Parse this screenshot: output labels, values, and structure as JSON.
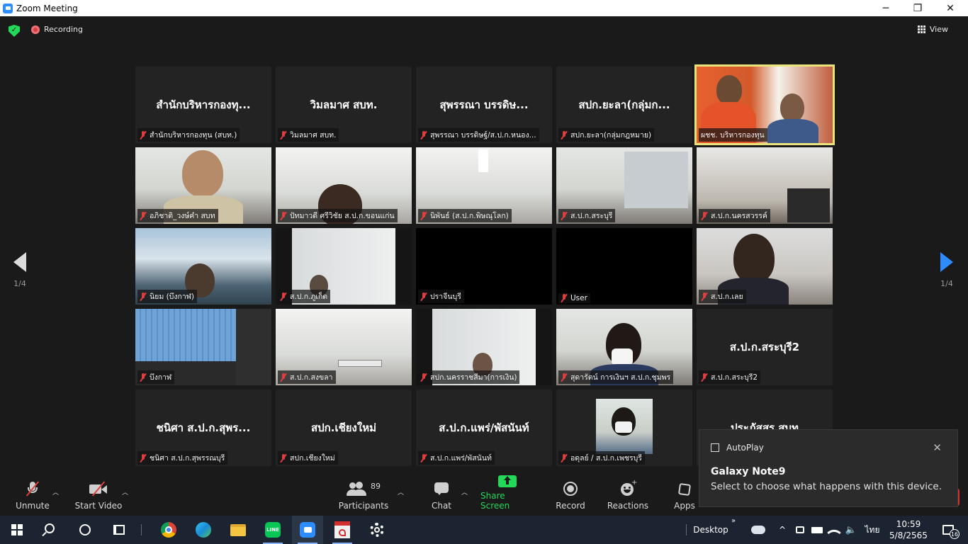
{
  "window": {
    "title": "Zoom Meeting",
    "minimize": "─",
    "maximize": "❐",
    "close": "✕"
  },
  "header": {
    "recording_label": "Recording",
    "view_label": "View"
  },
  "pager": {
    "left_count": "1/4",
    "right_count": "1/4",
    "arrow_color": "#2d8cff"
  },
  "tiles": [
    {
      "name": "สำนักบริหารกองทุ...",
      "label": "สำนักบริหารกองทุน (สบท.)",
      "type": "name"
    },
    {
      "name": "วิมลมาศ สบท.",
      "label": "วิมลมาศ สบท.",
      "type": "name"
    },
    {
      "name": "สุพรรณา บรรดิษ...",
      "label": "สุพรรณา บรรดิษฐ์/ส.ป.ก.หนอง...",
      "type": "name"
    },
    {
      "name": "สปก.ยะลา(กลุ่มก...",
      "label": "สปก.ยะลา(กลุ่มกฎหมาย)",
      "type": "name"
    },
    {
      "name": "",
      "label": "ผชช. บริหารกองทุน",
      "type": "video"
    },
    {
      "name": "",
      "label": "อภิชาติ_วงษ์คำ สบท",
      "type": "video"
    },
    {
      "name": "",
      "label": "ปัทมาวดี ศรีวิชัย ส.ป.ก.ขอนแก่น",
      "type": "video"
    },
    {
      "name": "",
      "label": "นิพันธ์ (ส.ป.ก.พิษณุโลก)",
      "type": "video"
    },
    {
      "name": "",
      "label": "ส.ป.ก.สระบุรี",
      "type": "video"
    },
    {
      "name": "",
      "label": "ส.ป.ก.นครสวรรค์",
      "type": "video"
    },
    {
      "name": "",
      "label": "นิยม (บึงกาฬ)",
      "type": "video"
    },
    {
      "name": "",
      "label": "ส.ป.ก.ภูเก็ต",
      "type": "video"
    },
    {
      "name": "",
      "label": "ปราจีนบุรี",
      "type": "black"
    },
    {
      "name": "",
      "label": "User",
      "type": "black"
    },
    {
      "name": "",
      "label": "ส.ป.ก.เลย",
      "type": "video"
    },
    {
      "name": "",
      "label": "บึงกาฬ",
      "type": "video"
    },
    {
      "name": "",
      "label": "ส.ป.ก.สงขลา",
      "type": "video"
    },
    {
      "name": "",
      "label": "สปก.นครราชสีมา(การเงิน)",
      "type": "video"
    },
    {
      "name": "",
      "label": "สุดารัตน์ การเงินฯ ส.ป.ก.ชุมพร",
      "type": "video"
    },
    {
      "name": "ส.ป.ก.สระบุรี2",
      "label": "ส.ป.ก.สระบุรี2",
      "type": "name"
    },
    {
      "name": "ชนิศา ส.ป.ก.สุพร...",
      "label": "ชนิศา ส.ป.ก.สุพรรณบุรี",
      "type": "name"
    },
    {
      "name": "สปก.เชียงใหม่",
      "label": "สปก.เชียงใหม่",
      "type": "name"
    },
    {
      "name": "ส.ป.ก.แพร่/พัสนันท์",
      "label": "ส.ป.ก.แพร่/พัสนันท์",
      "type": "name"
    },
    {
      "name": "",
      "label": "อดุลย์ / ส.ป.ก.เพชรบุรี",
      "type": "video"
    },
    {
      "name": "ประภัสสร สบท",
      "label": "",
      "type": "name"
    }
  ],
  "toolbar": {
    "unmute": "Unmute",
    "start_video": "Start Video",
    "participants": "Participants",
    "participants_count": "89",
    "chat": "Chat",
    "share_screen": "Share Screen",
    "record": "Record",
    "reactions": "Reactions",
    "apps": "Apps",
    "share_color": "#23d959"
  },
  "toast": {
    "app": "AutoPlay",
    "title": "Galaxy Note9",
    "body": "Select to choose what happens with this device.",
    "close": "✕"
  },
  "taskbar": {
    "desktop_label": "Desktop",
    "language": "ไทย",
    "time": "10:59",
    "date": "5/8/2565",
    "notification_count": "16"
  }
}
